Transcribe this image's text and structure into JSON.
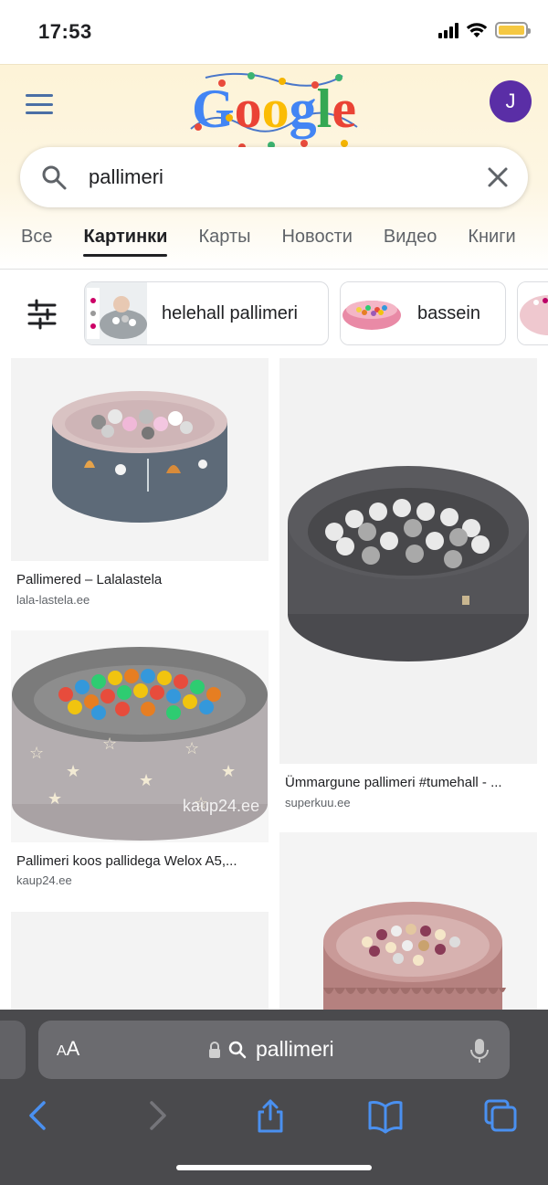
{
  "status_bar": {
    "time": "17:53",
    "battery_color": "#f5c842"
  },
  "header": {
    "logo_text": "Google",
    "avatar_letter": "J",
    "avatar_color": "#5a2ea6"
  },
  "search": {
    "query": "pallimeri"
  },
  "tabs": [
    {
      "label": "Все",
      "active": false
    },
    {
      "label": "Картинки",
      "active": true
    },
    {
      "label": "Карты",
      "active": false
    },
    {
      "label": "Новости",
      "active": false
    },
    {
      "label": "Видео",
      "active": false
    },
    {
      "label": "Книги",
      "active": false
    }
  ],
  "chips": [
    {
      "label": "helehall pallimeri"
    },
    {
      "label": "bassein"
    }
  ],
  "results": [
    {
      "title": "Pallimered – Lalalastela",
      "source": "lala-lastela.ee"
    },
    {
      "title": "Ümmargune pallimeri #tumehall - ...",
      "source": "superkuu.ee"
    },
    {
      "title": "Pallimeri koos pallidega Welox A5,...",
      "source": "kaup24.ee",
      "watermark": "kaup24.ee"
    }
  ],
  "safari": {
    "text_size_label_small": "A",
    "text_size_label_large": "A",
    "address": "pallimeri"
  },
  "icons": [
    "menu-icon",
    "search-icon",
    "close-icon",
    "tune-icon",
    "lock-icon",
    "mic-icon",
    "back-icon",
    "forward-icon",
    "share-icon",
    "bookmarks-icon",
    "tabs-icon"
  ]
}
